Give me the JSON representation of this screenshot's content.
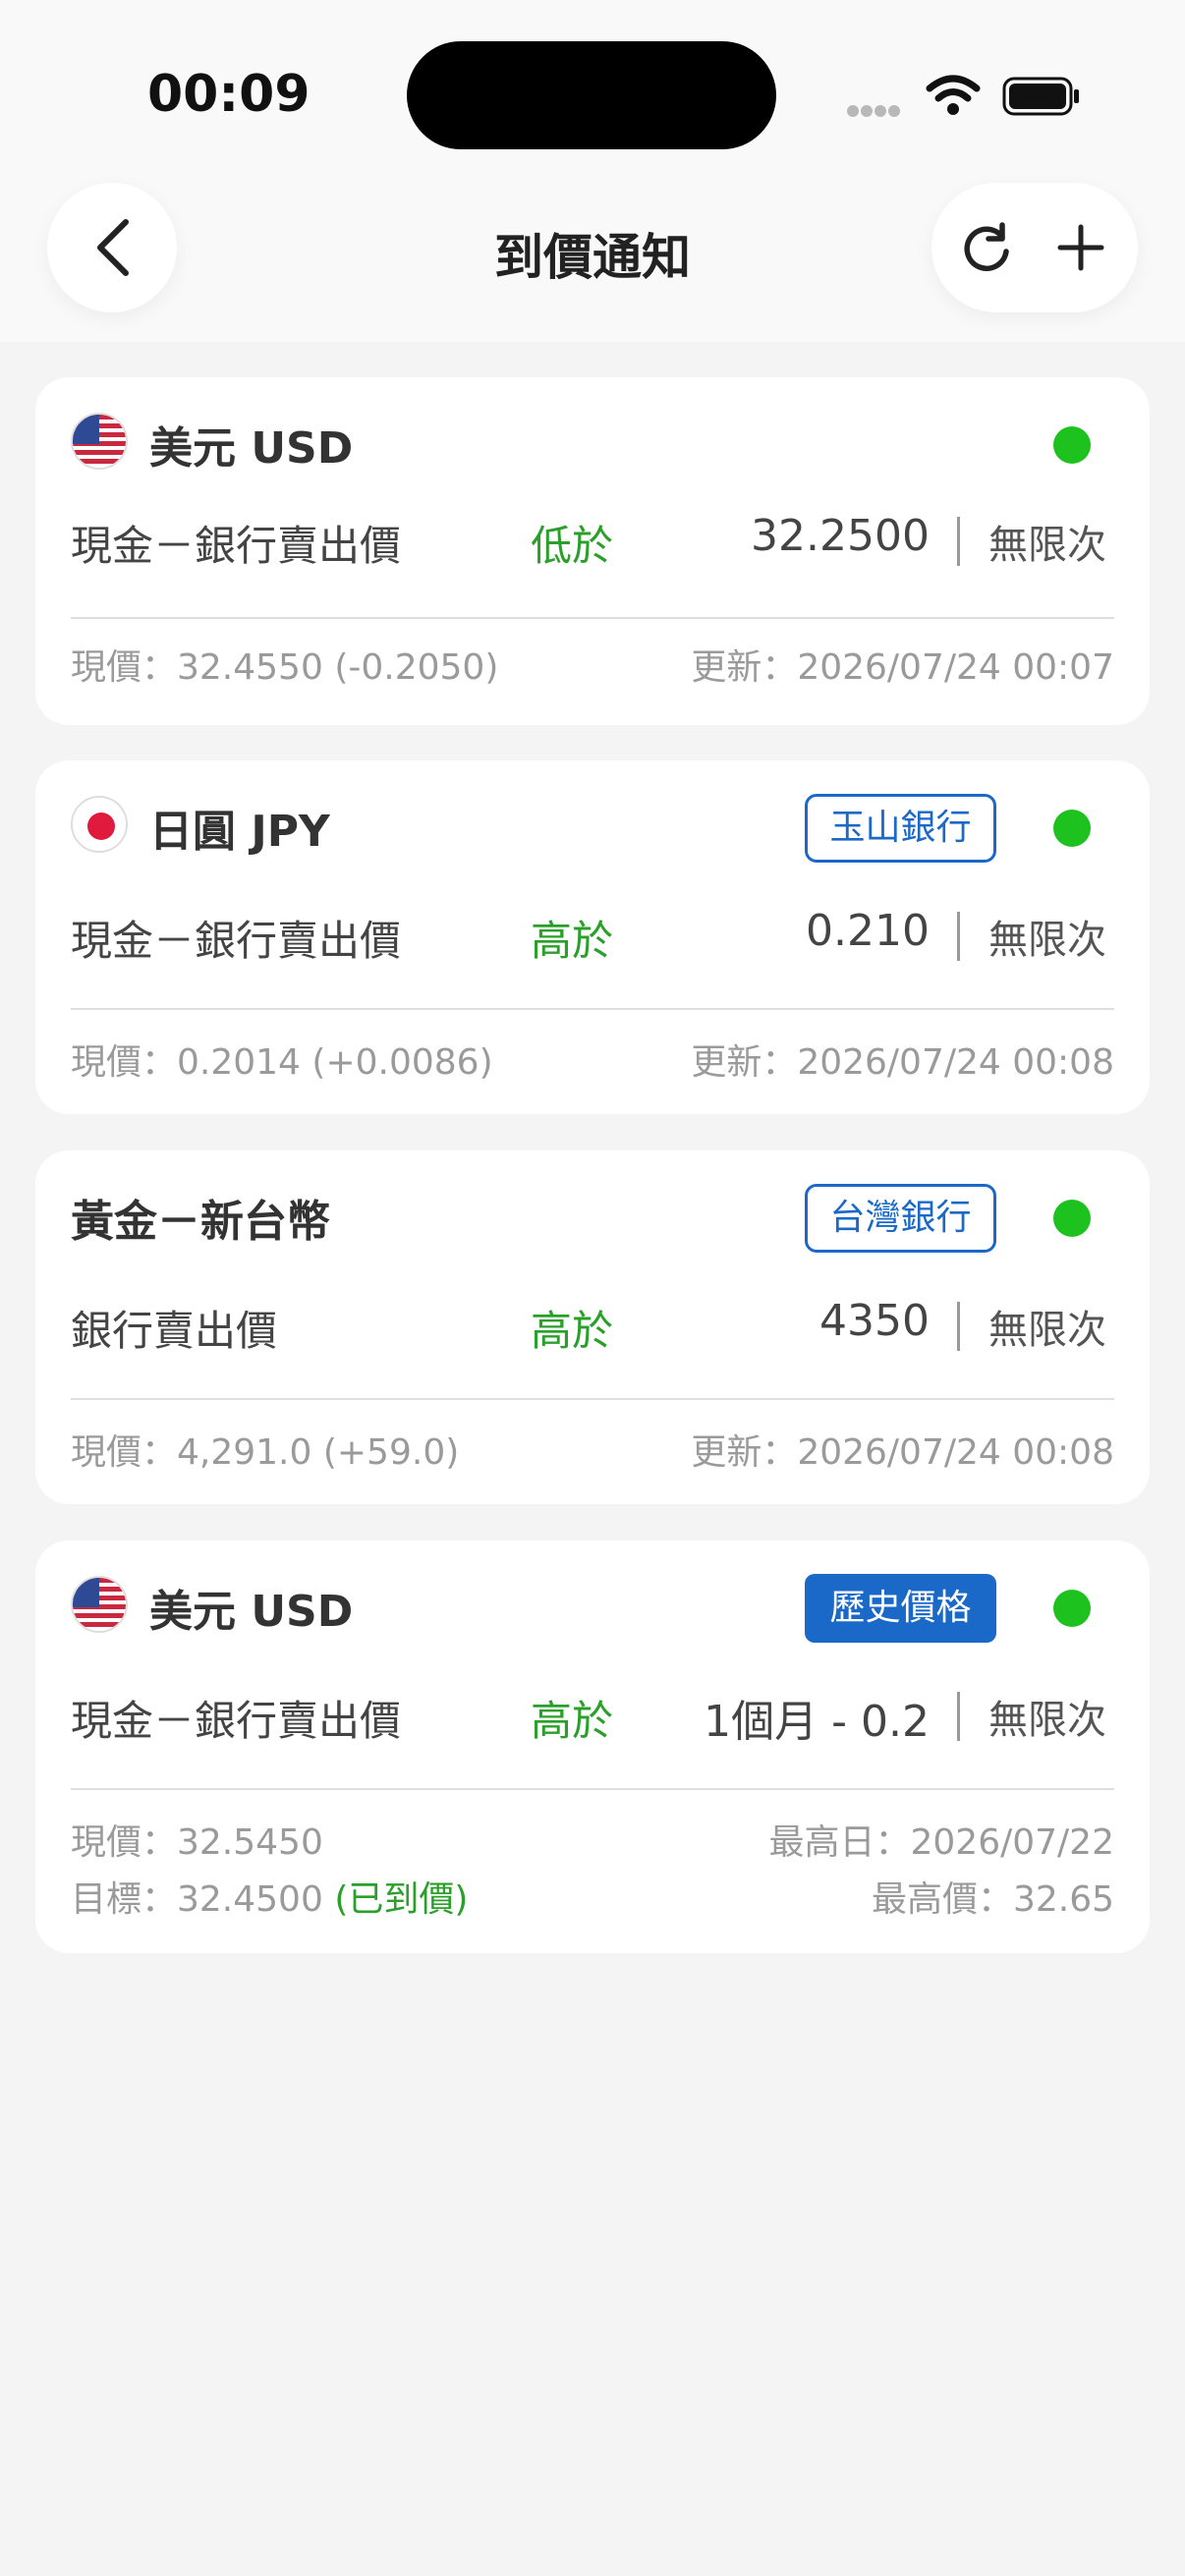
{
  "status_bar": {
    "time": "00:09"
  },
  "header": {
    "title": "到價通知"
  },
  "alerts": [
    {
      "title": "美元 USD",
      "flag": "us-flag",
      "badge": "",
      "label": "現金－銀行賣出價",
      "condition": "低於",
      "target": "32.2500",
      "repeat": "無限次",
      "current": "現價：32.4550 (-0.2050)",
      "updated": "更新：2026/07/24 00:07",
      "active": true
    },
    {
      "title": "日圓 JPY",
      "flag": "jp-flag",
      "badge": "玉山銀行",
      "label": "現金－銀行賣出價",
      "condition": "高於",
      "target": "0.210",
      "repeat": "無限次",
      "current": "現價：0.2014 (+0.0086)",
      "updated": "更新：2026/07/24 00:08",
      "active": true
    },
    {
      "title": "黃金－新台幣",
      "flag": "",
      "badge": "台灣銀行",
      "label": "銀行賣出價",
      "condition": "高於",
      "target": "4350",
      "repeat": "無限次",
      "current": "現價：4,291.0 (+59.0)",
      "updated": "更新：2026/07/24 00:08",
      "active": true
    },
    {
      "title": "美元 USD",
      "flag": "us-flag",
      "badge": "歷史價格",
      "label": "現金－銀行賣出價",
      "condition": "高於",
      "target": "1個月 - 0.2",
      "repeat": "無限次",
      "current": "現價：32.5450",
      "goal_prefix": "目標：32.4500 ",
      "goal_status": "(已到價)",
      "high_day": "最高日：2026/07/22",
      "high_price": "最高價：32.65",
      "active": true
    }
  ],
  "colors": {
    "accent_blue": "#1a68c8",
    "active_green": "#1ec21e",
    "condition_green": "#2aa02a"
  }
}
